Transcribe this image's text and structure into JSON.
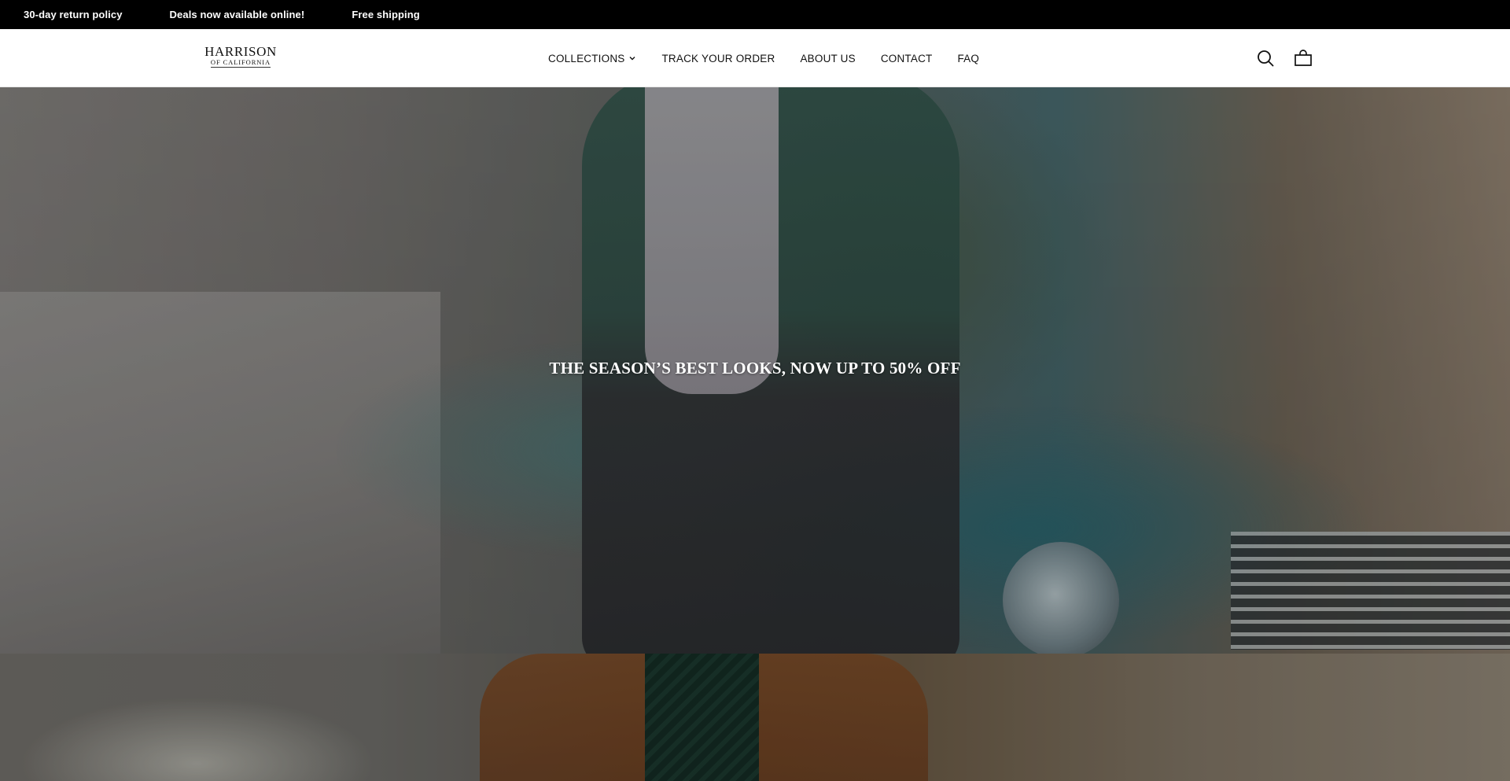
{
  "announcement": {
    "items": [
      "30-day return policy",
      "Deals now available online!",
      "Free shipping"
    ]
  },
  "header": {
    "logo": {
      "main": "HARRISON",
      "sub": "OF CALIFORNIA"
    },
    "nav": {
      "collections": "COLLECTIONS",
      "track": "TRACK YOUR ORDER",
      "about": "ABOUT US",
      "contact": "CONTACT",
      "faq": "FAQ"
    },
    "icons": {
      "search": "search-icon",
      "cart": "shopping-bag-icon",
      "dropdown": "chevron-down-icon"
    }
  },
  "hero": {
    "title": "THE SEASON’S BEST LOOKS, NOW UP TO 50% OFF"
  },
  "colors": {
    "announcement_bg": "#000000",
    "announcement_text": "#ffffff",
    "header_bg": "#ffffff",
    "nav_text": "#111111",
    "hero_text": "#ffffff"
  }
}
